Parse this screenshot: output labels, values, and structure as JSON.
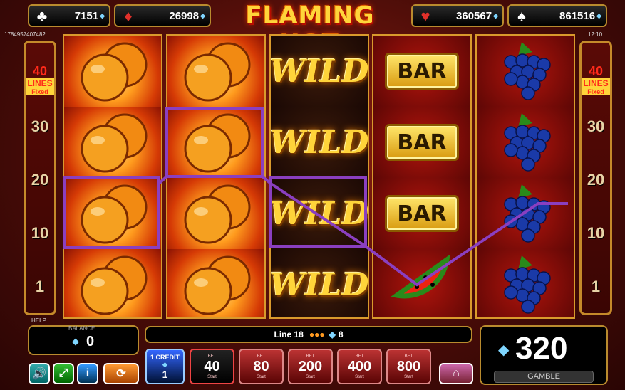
{
  "title": "FLAMING HOT",
  "jackpots": [
    {
      "suit": "clubs-icon",
      "glyph": "♣",
      "value": "7151",
      "color": "#ffffff"
    },
    {
      "suit": "diamonds-icon",
      "glyph": "♦",
      "value": "26998",
      "color": "#e0302a"
    },
    {
      "suit": "hearts-icon",
      "glyph": "♥",
      "value": "360567",
      "color": "#e0302a"
    },
    {
      "suit": "spades-icon",
      "glyph": "♠",
      "value": "861516",
      "color": "#ffffff"
    }
  ],
  "game_id": "1784957407482",
  "clock": "12:10",
  "lines_panel": {
    "count": "40",
    "lines": "LINES",
    "fixed": "Fixed",
    "marks": [
      "30",
      "20",
      "10",
      "1"
    ]
  },
  "reels": [
    {
      "symbols": [
        "orange",
        "orange",
        "orange",
        "orange"
      ]
    },
    {
      "symbols": [
        "orange",
        "orange",
        "orange",
        "orange"
      ]
    },
    {
      "symbols": [
        "wild",
        "wild",
        "wild",
        "wild"
      ]
    },
    {
      "symbols": [
        "bar",
        "bar",
        "bar",
        "watermelon"
      ]
    },
    {
      "symbols": [
        "grapes",
        "grapes",
        "grapes",
        "grapes"
      ]
    }
  ],
  "wild_text": "WILD",
  "bar_text": "BAR",
  "help": "HELP",
  "balance": {
    "label": "BALANCE",
    "value": "0"
  },
  "win_line": {
    "text": "Line 18",
    "count": "8"
  },
  "win": {
    "value": "320",
    "gamble": "GAMBLE"
  },
  "credit": {
    "label": "1 CREDIT",
    "value": "1"
  },
  "bets": [
    {
      "top": "BET",
      "value": "40",
      "bottom": "Start",
      "active": true
    },
    {
      "top": "BET",
      "value": "80",
      "bottom": "Start"
    },
    {
      "top": "BET",
      "value": "200",
      "bottom": "Start"
    },
    {
      "top": "BET",
      "value": "400",
      "bottom": "Start"
    },
    {
      "top": "BET",
      "value": "800",
      "bottom": "Start"
    }
  ],
  "colors": {
    "gold": "#b98b2e",
    "paylines": "#8a3fc0"
  }
}
